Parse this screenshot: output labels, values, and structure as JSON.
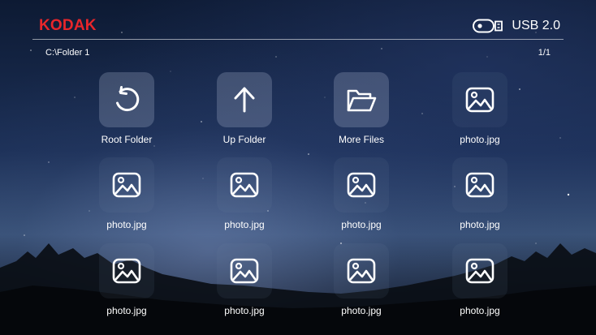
{
  "header": {
    "brand": "KODAK",
    "device_label": "USB 2.0",
    "brand_color": "#e8262b"
  },
  "location": {
    "path": "C:\\Folder 1",
    "page_indicator": "1/1"
  },
  "items": [
    {
      "label": "Root Folder",
      "icon": "rotate-icon",
      "kind": "nav"
    },
    {
      "label": "Up Folder",
      "icon": "arrow-up-icon",
      "kind": "nav"
    },
    {
      "label": "More Files",
      "icon": "folder-icon",
      "kind": "nav"
    },
    {
      "label": "photo.jpg",
      "icon": "image-icon",
      "kind": "file"
    },
    {
      "label": "photo.jpg",
      "icon": "image-icon",
      "kind": "file"
    },
    {
      "label": "photo.jpg",
      "icon": "image-icon",
      "kind": "file"
    },
    {
      "label": "photo.jpg",
      "icon": "image-icon",
      "kind": "file"
    },
    {
      "label": "photo.jpg",
      "icon": "image-icon",
      "kind": "file"
    },
    {
      "label": "photo.jpg",
      "icon": "image-icon",
      "kind": "file"
    },
    {
      "label": "photo.jpg",
      "icon": "image-icon",
      "kind": "file"
    },
    {
      "label": "photo.jpg",
      "icon": "image-icon",
      "kind": "file"
    },
    {
      "label": "photo.jpg",
      "icon": "image-icon",
      "kind": "file"
    }
  ]
}
